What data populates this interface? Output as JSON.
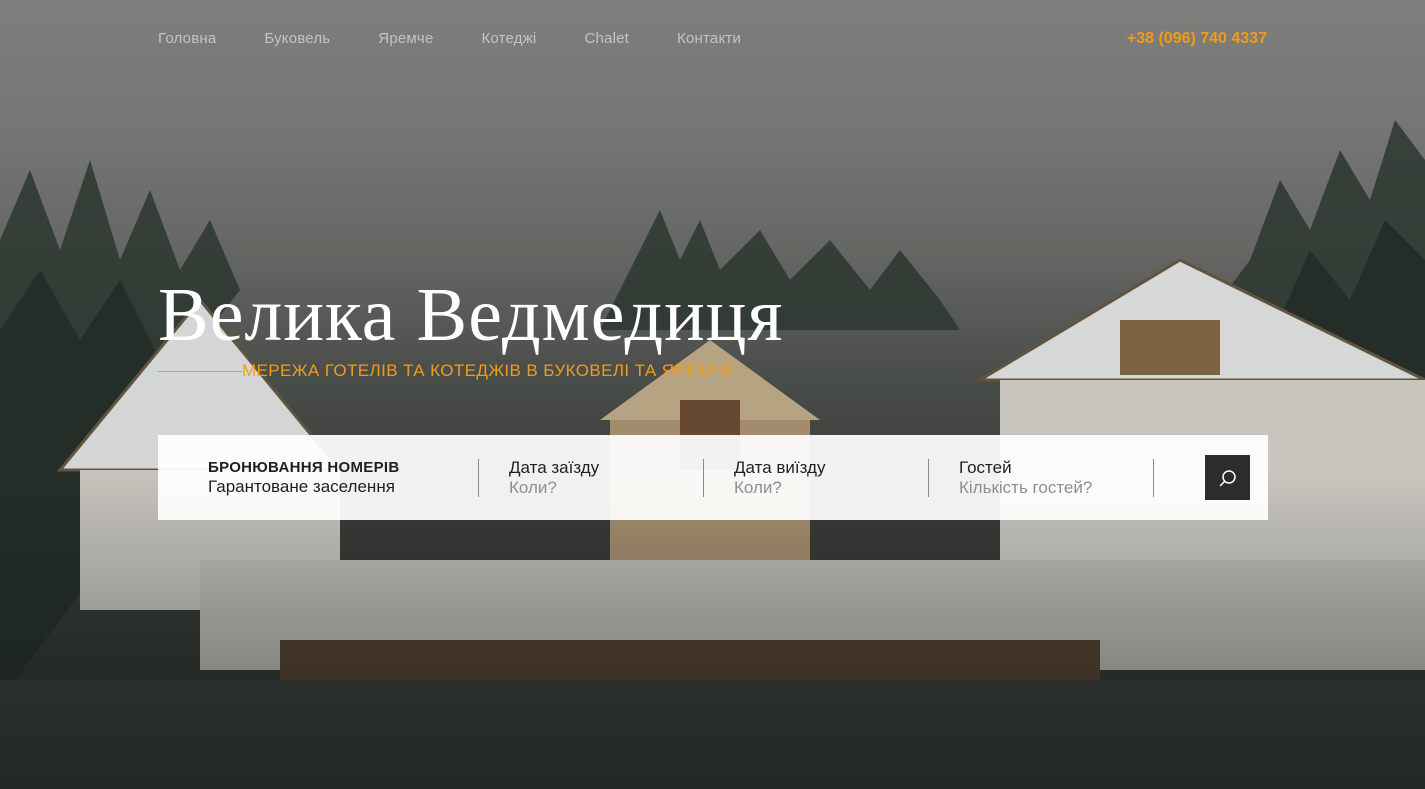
{
  "nav": {
    "items": [
      {
        "label": "Головна"
      },
      {
        "label": "Буковель"
      },
      {
        "label": "Яремче"
      },
      {
        "label": "Котеджі"
      },
      {
        "label": "Chalet"
      },
      {
        "label": "Контакти"
      }
    ],
    "phone": "+38 (096) 740 4337"
  },
  "hero": {
    "title": "Велика Ведмедиця",
    "subtitle": "Мережа готелів та котеджів в Буковелі та Яремче"
  },
  "booking": {
    "heading": "БРОНЮВАННЯ НОМЕРІВ",
    "tagline": "Гарантоване заселення",
    "checkin": {
      "label": "Дата заїзду",
      "placeholder": "Коли?"
    },
    "checkout": {
      "label": "Дата виїзду",
      "placeholder": "Коли?"
    },
    "guests": {
      "label": "Гостей",
      "placeholder": "Кількість гостей?"
    },
    "search_icon": "search-icon"
  },
  "colors": {
    "accent": "#f39a1b",
    "button": "#2c2c2c"
  }
}
